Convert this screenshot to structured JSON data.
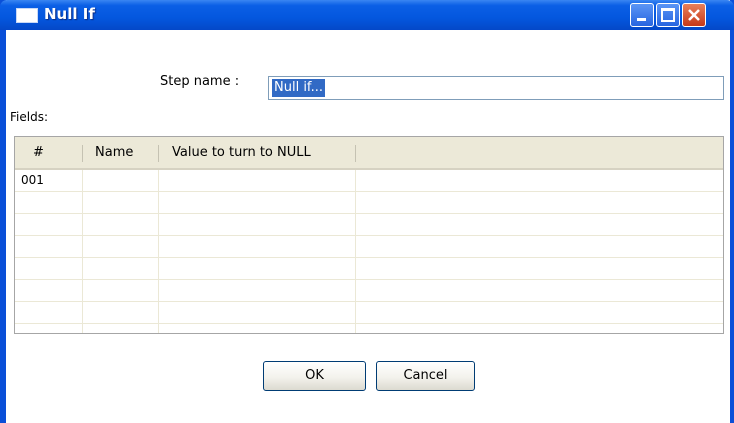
{
  "window": {
    "title": "Null If",
    "icon": "window-icon",
    "controls": [
      "minimize-icon",
      "maximize-icon",
      "close-icon"
    ],
    "accent": "#0a4fd8"
  },
  "form": {
    "step_name_label": "Step name :",
    "step_name_value": "Null if...",
    "fields_label": "Fields:"
  },
  "table": {
    "columns": [
      "#",
      "Name",
      "Value to turn to NULL",
      ""
    ],
    "rows": [
      {
        "num": "001",
        "name": "",
        "value": ""
      },
      {
        "num": "",
        "name": "",
        "value": ""
      },
      {
        "num": "",
        "name": "",
        "value": ""
      },
      {
        "num": "",
        "name": "",
        "value": ""
      },
      {
        "num": "",
        "name": "",
        "value": ""
      },
      {
        "num": "",
        "name": "",
        "value": ""
      },
      {
        "num": "",
        "name": "",
        "value": ""
      },
      {
        "num": "",
        "name": "",
        "value": ""
      }
    ]
  },
  "buttons": {
    "ok": "OK",
    "cancel": "Cancel"
  }
}
